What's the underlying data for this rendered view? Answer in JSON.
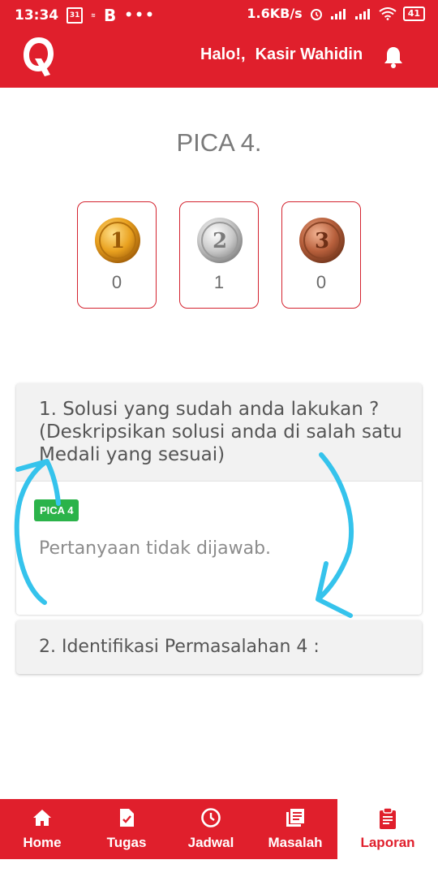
{
  "status_bar": {
    "time": "13:34",
    "calendar_day": "31",
    "network_speed": "1.6KB/s",
    "battery": "41"
  },
  "header": {
    "greeting": "Halo!,",
    "user_name": "Kasir Wahidin"
  },
  "page": {
    "title": "PICA 4."
  },
  "medals": [
    {
      "type": "gold",
      "icon": "gold-medal-icon",
      "count": "0"
    },
    {
      "type": "silver",
      "icon": "silver-medal-icon",
      "count": "1"
    },
    {
      "type": "bronze",
      "icon": "bronze-medal-icon",
      "count": "0"
    }
  ],
  "questions": [
    {
      "text": "1. Solusi yang sudah anda lakukan ? (Deskripsikan solusi anda di salah satu Medali yang sesuai)",
      "badge": "PICA 4",
      "answer": "Pertanyaan tidak dijawab."
    },
    {
      "text": "2. Identifikasi Permasalahan 4 :"
    }
  ],
  "bottom_nav": [
    {
      "label": "Home",
      "icon": "home-icon"
    },
    {
      "label": "Tugas",
      "icon": "task-icon"
    },
    {
      "label": "Jadwal",
      "icon": "clock-icon"
    },
    {
      "label": "Masalah",
      "icon": "list-icon"
    },
    {
      "label": "Laporan",
      "icon": "clipboard-icon",
      "active": true
    }
  ],
  "colors": {
    "primary": "#e01f2c",
    "badge": "#2bb34a",
    "annotation": "#35c3ec"
  }
}
